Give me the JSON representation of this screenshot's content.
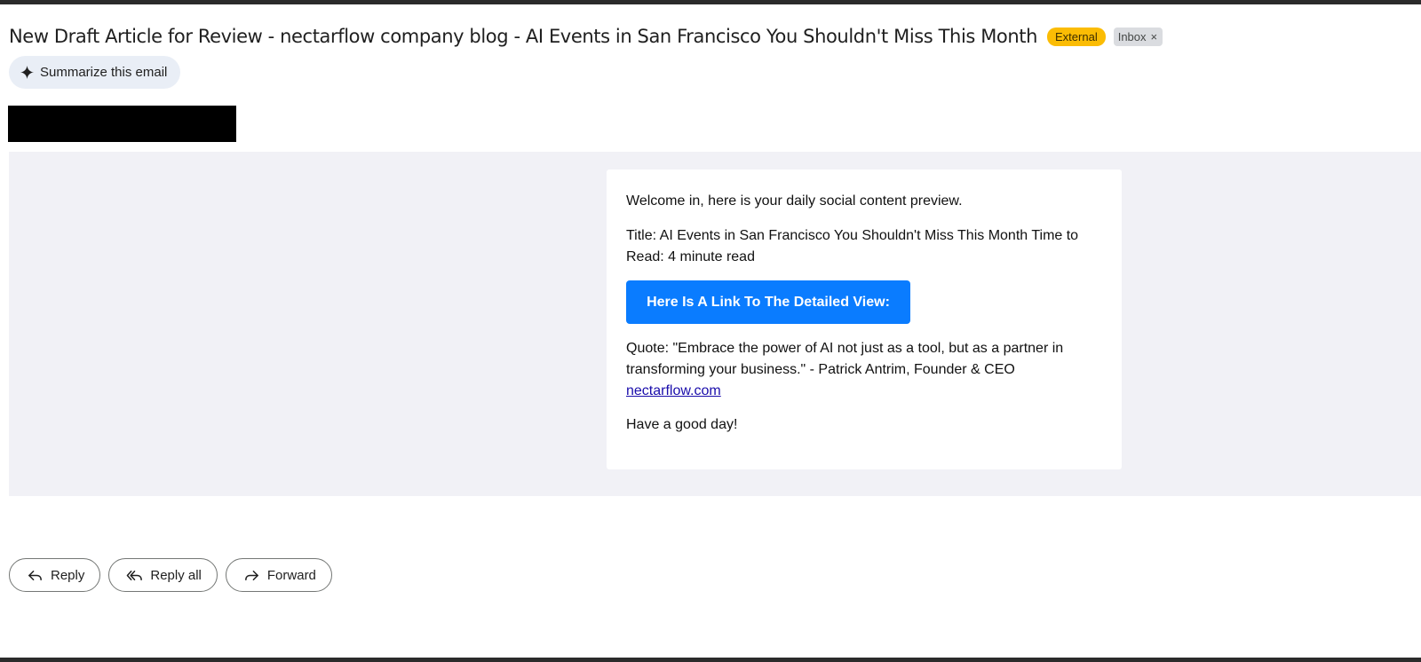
{
  "email": {
    "subject": "New Draft Article for Review - nectarflow company blog - AI Events in San Francisco You Shouldn't Miss This Month",
    "labels": {
      "external": "External",
      "inbox": "Inbox"
    },
    "summarize_label": "Summarize this email"
  },
  "body": {
    "welcome": "Welcome in, here is your daily social content preview.",
    "title_line": "Title: AI Events in San Francisco You Shouldn't Miss This Month Time to Read: 4 minute read",
    "cta_label": "Here Is A Link To The Detailed View:",
    "quote_text": "Quote: \"Embrace the power of AI not just as a tool, but as a partner in transforming your business.\" - Patrick Antrim, Founder & CEO",
    "quote_link": "nectarflow.com",
    "closing": "Have a good day!"
  },
  "actions": {
    "reply": "Reply",
    "reply_all": "Reply all",
    "forward": "Forward"
  },
  "icons": {
    "summarize": "sparkle-icon",
    "inbox_remove": "close-icon",
    "reply": "reply-icon",
    "reply_all": "reply-all-icon",
    "forward": "forward-icon"
  },
  "colors": {
    "external_badge": "#fbbc04",
    "cta_button": "#0a7cff",
    "link": "#1a0dab",
    "body_background": "#f1f1f6"
  }
}
